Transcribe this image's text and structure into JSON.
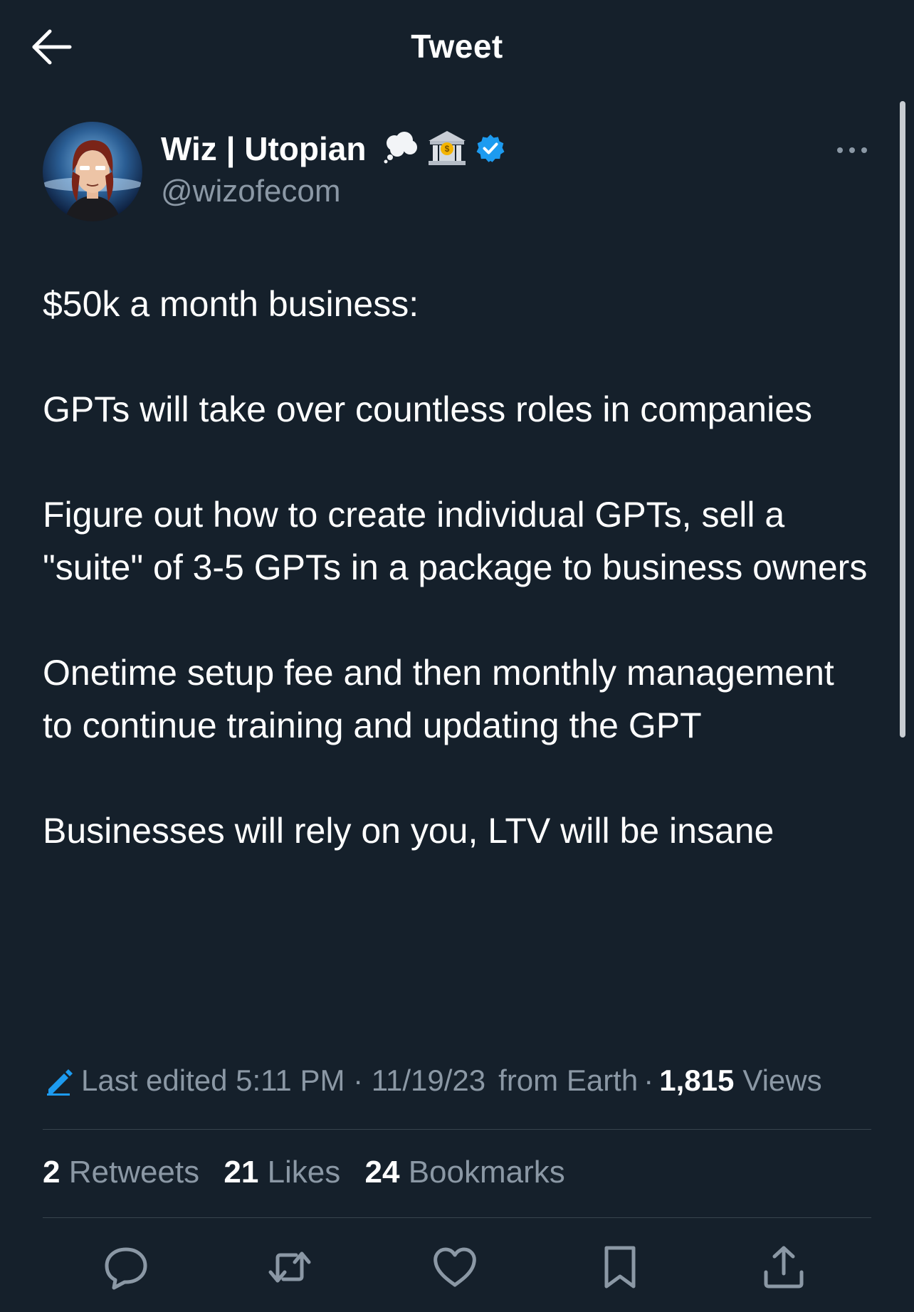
{
  "header": {
    "title": "Tweet",
    "back_icon": "arrow-left-icon"
  },
  "author": {
    "name": "Wiz | Utopian",
    "handle": "@wizofecom",
    "badges": [
      "thought-bubble-icon",
      "bank-icon",
      "verified-badge-icon"
    ]
  },
  "tweet": {
    "paragraphs": [
      "$50k a month business:",
      "GPTs will take over countless roles in companies",
      "Figure out how to create individual GPTs, sell a \"suite\" of 3-5 GPTs in a package to business owners",
      "Onetime setup fee and then monthly management to continue training and updating the GPT",
      "Businesses will rely on you, LTV will be insane"
    ]
  },
  "meta": {
    "edited_label": "Last edited 5:11 PM · 11/19/23",
    "location": "from Earth",
    "separator": "·",
    "views_count": "1,815",
    "views_label": "Views"
  },
  "stats": {
    "retweets_count": "2",
    "retweets_label": "Retweets",
    "likes_count": "21",
    "likes_label": "Likes",
    "bookmarks_count": "24",
    "bookmarks_label": "Bookmarks"
  },
  "actions": [
    "reply-icon",
    "retweet-icon",
    "like-icon",
    "bookmark-icon",
    "share-icon"
  ],
  "colors": {
    "background": "#15202b",
    "text": "#ffffff",
    "secondary_text": "#8b98a5",
    "verified": "#1d9bf0",
    "divider": "#38444d"
  }
}
